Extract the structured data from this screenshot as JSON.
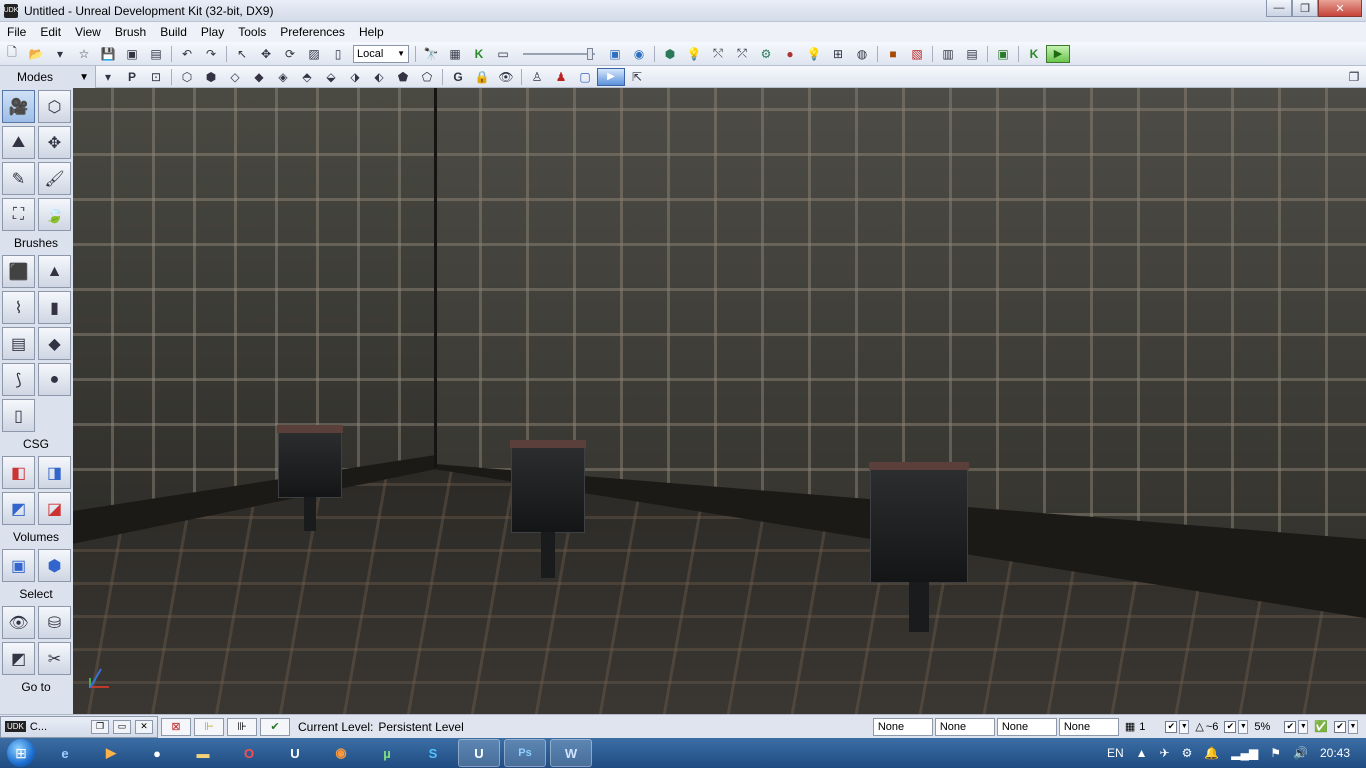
{
  "window": {
    "title": "Untitled - Unreal Development Kit (32-bit, DX9)",
    "app_icon_text": "UDK",
    "minimize": "—",
    "restore": "❐",
    "close": "✕"
  },
  "menu": [
    "File",
    "Edit",
    "View",
    "Brush",
    "Build",
    "Play",
    "Tools",
    "Preferences",
    "Help"
  ],
  "toolbar": {
    "coord_system": "Local",
    "kismet_label": "K"
  },
  "modes_panel": {
    "title": "Modes",
    "sections": {
      "brushes": "Brushes",
      "csg": "CSG",
      "volumes": "Volumes",
      "select": "Select",
      "goto": "Go to"
    }
  },
  "status_bar": {
    "minimized_window": "C...",
    "current_level_label": "Current Level:",
    "current_level_value": "Persistent Level",
    "fields": [
      "None",
      "None",
      "None",
      "None"
    ],
    "grid_value": "1",
    "angle_value": "~6",
    "scale_value": "5%"
  },
  "taskbar": {
    "language": "EN",
    "time": "20:43",
    "apps": [
      "IE",
      "Media",
      "Game",
      "Explorer",
      "Opera",
      "UDK",
      "Firefox",
      "Utorrent",
      "Skype",
      "UDK Editor",
      "Photoshop",
      "Word"
    ]
  },
  "colors": {
    "title_bar": "#d3dbe9",
    "taskbar": "#1f4c82",
    "play_green": "#6bc44e",
    "viewport_bg": "#1b1a17"
  }
}
